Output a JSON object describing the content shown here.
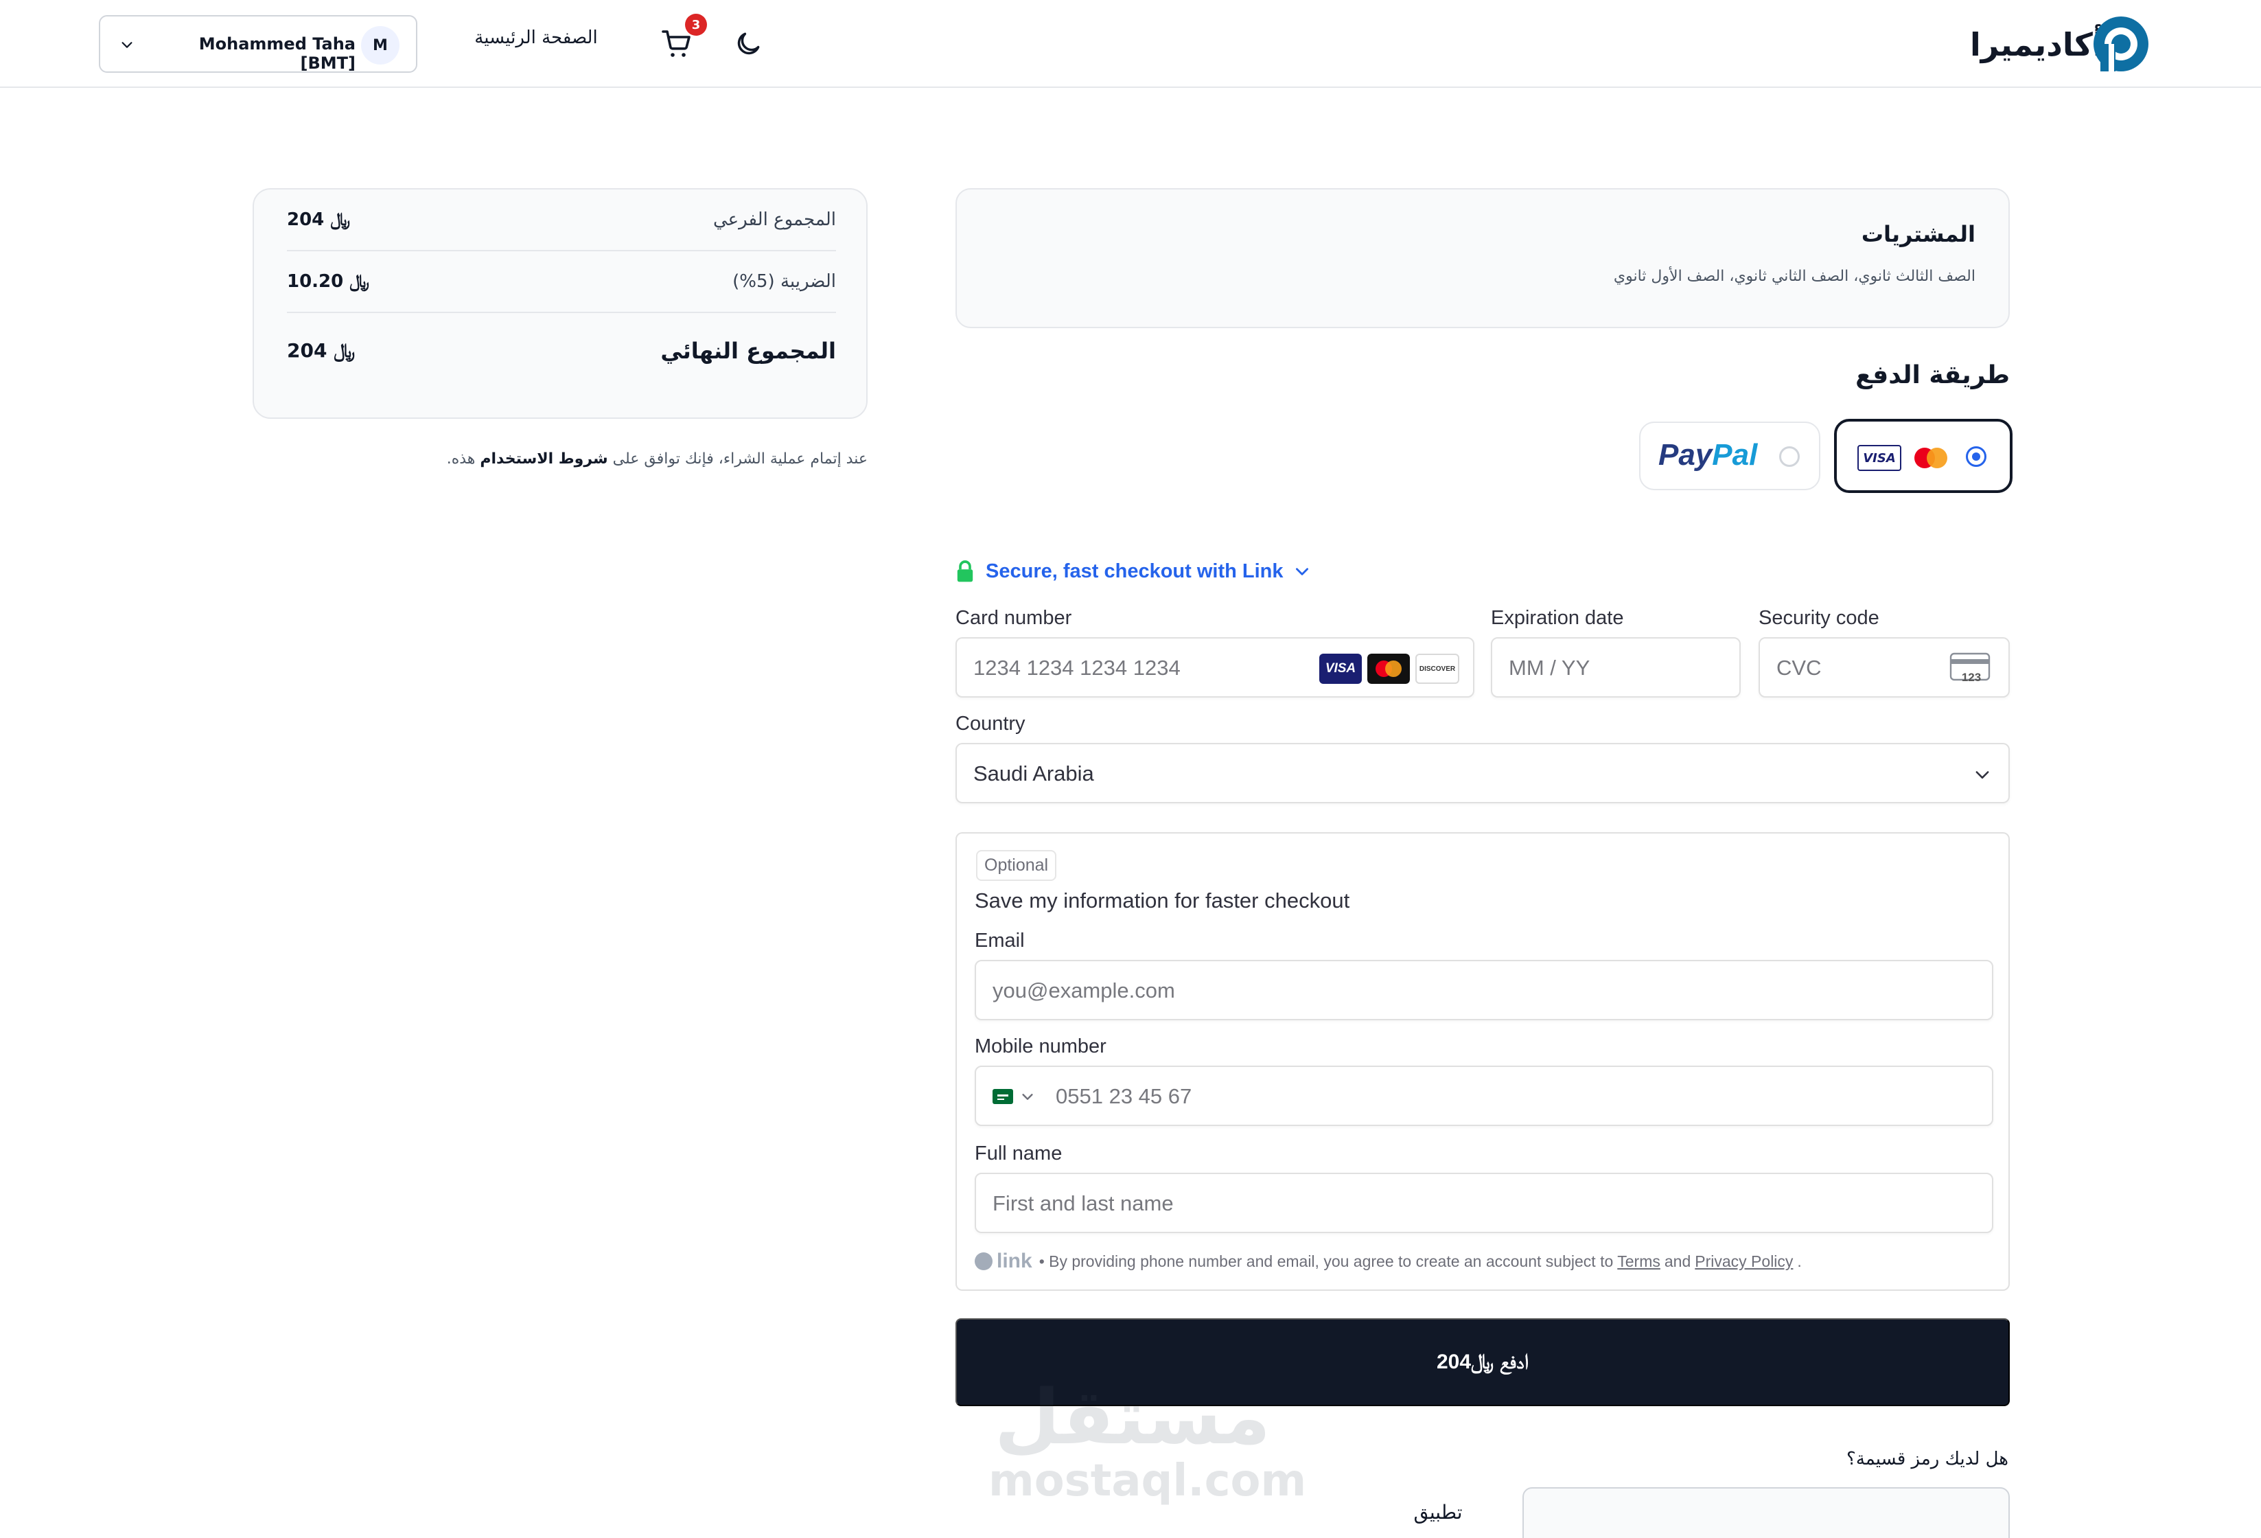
{
  "header": {
    "user_name": "Mohammed Taha [BMT]",
    "avatar_initial": "M",
    "home_label": "الصفحة الرئيسية",
    "cart_count": "3",
    "brand_name": "أكاديميرا"
  },
  "summary": {
    "subtotal_label": "المجموع الفرعي",
    "subtotal_value": "204 ﷼",
    "tax_label": "الضريبة (5%)",
    "tax_value": "10.20 ﷼",
    "total_label": "المجموع النهائي",
    "total_value": "204 ﷼",
    "terms_prefix": "عند إتمام عملية الشراء، فإنك توافق على ",
    "terms_link": "شروط الاستخدام",
    "terms_suffix": " هذه."
  },
  "purchases": {
    "title": "المشتريات",
    "items": "الصف الثالث ثانوي، الصف الثاني ثانوي، الصف الأول ثانوي"
  },
  "payment": {
    "title": "طريقة الدفع",
    "selected": "card",
    "card_brands": [
      "VISA",
      "MasterCard"
    ],
    "paypal_label_pay": "Pay",
    "paypal_label_pal": "Pal"
  },
  "stripe": {
    "link_text": "Secure, fast checkout with Link",
    "card_number_label": "Card number",
    "card_number_placeholder": "1234 1234 1234 1234",
    "card_brand_visa": "VISA",
    "card_brand_discover": "DISCOVER",
    "expiry_label": "Expiration date",
    "expiry_placeholder": "MM / YY",
    "cvc_label": "Security code",
    "cvc_placeholder": "CVC",
    "cvc_icon_text": "123",
    "country_label": "Country",
    "country_value": "Saudi Arabia",
    "optional_chip": "Optional",
    "save_title": "Save my information for faster checkout",
    "email_label": "Email",
    "email_placeholder": "you@example.com",
    "mobile_label": "Mobile number",
    "mobile_placeholder": "0551 23 45 67",
    "fullname_label": "Full name",
    "fullname_placeholder": "First and last name",
    "legal_logo": "link",
    "legal_text": "• By providing phone number and email, you agree to create an account subject to",
    "legal_terms": "Terms",
    "legal_and": "and",
    "legal_privacy": "Privacy Policy",
    "legal_end": "."
  },
  "pay_button": "ادفع ﷼204",
  "watermark": {
    "ar": "مستقل",
    "en": "mostaql.com"
  },
  "coupon": {
    "question": "هل لديك رمز قسيمة؟",
    "apply_label": "تطبيق"
  },
  "colors": {
    "primary": "#111827",
    "link_blue": "#2563eb",
    "badge_red": "#dc2626",
    "lock_green": "#22c55e",
    "brand_blue": "#0e6fa3"
  }
}
